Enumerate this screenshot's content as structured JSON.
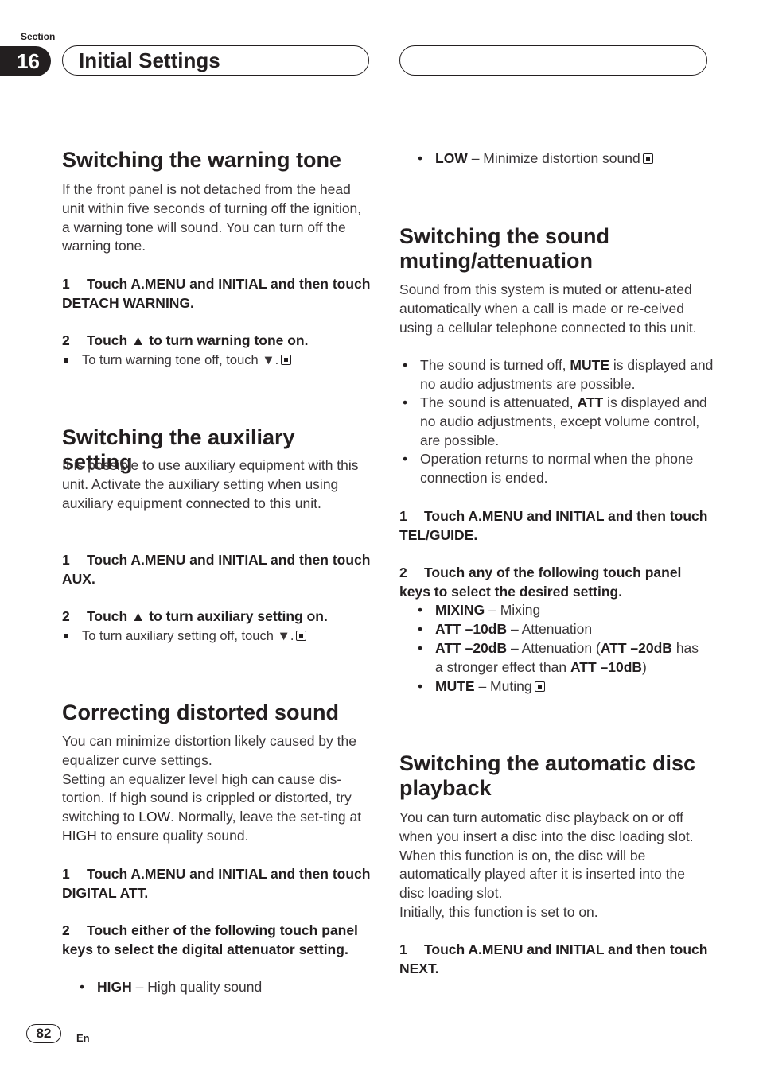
{
  "header": {
    "section_label": "Section",
    "section_number": "16",
    "title": "Initial Settings"
  },
  "warning_tone": {
    "heading": "Switching the warning tone",
    "intro": "If the front panel is not detached from the head unit within five seconds of turning off the ignition, a warning tone will sound. You can turn off the warning tone.",
    "step1_num": "1",
    "step1": "Touch A.MENU and INITIAL and then touch DETACH WARNING.",
    "step2_num": "2",
    "step2": "Touch ▲ to turn warning tone on.",
    "note": "To turn warning tone off, touch ▼."
  },
  "auxiliary": {
    "heading": "Switching the auxiliary setting",
    "intro": "It is possible to use auxiliary equipment with this unit. Activate the auxiliary setting when using auxiliary equipment connected to this unit.",
    "step1_num": "1",
    "step1": "Touch A.MENU and INITIAL and then touch AUX.",
    "step2_num": "2",
    "step2": "Touch ▲ to turn auxiliary setting on.",
    "note": "To turn auxiliary setting off, touch ▼."
  },
  "distorted": {
    "heading": "Correcting distorted sound",
    "intro1": "You can minimize distortion likely caused by the equalizer curve settings.",
    "intro2_a": "Setting an equalizer level high can cause dis-tortion. If high sound is crippled or distorted, try switching to ",
    "intro2_low": "LOW",
    "intro2_b": ". Normally, leave the set-ting at ",
    "intro2_high": "HIGH",
    "intro2_c": " to ensure quality sound.",
    "step1_num": "1",
    "step1": "Touch A.MENU and INITIAL and then touch DIGITAL ATT.",
    "step2_num": "2",
    "step2": "Touch either of the following touch panel keys to select the digital attenuator setting.",
    "options": [
      {
        "key": "HIGH",
        "desc": " – High quality sound"
      },
      {
        "key": "LOW",
        "desc": " – Minimize distortion sound"
      }
    ]
  },
  "muting": {
    "heading": "Switching the sound muting/attenuation",
    "intro": "Sound from this system is muted or attenu-ated automatically when a call is made or re-ceived using a cellular telephone connected to this unit.",
    "bullets": [
      {
        "a": "The sound is turned off, ",
        "b": "MUTE",
        "c": " is displayed and no audio adjustments are possible."
      },
      {
        "a": "The sound is attenuated, ",
        "b": "ATT",
        "c": " is displayed and no audio adjustments, except volume control, are possible."
      },
      {
        "a": "Operation returns to normal when the phone connection is ended.",
        "b": "",
        "c": ""
      }
    ],
    "step1_num": "1",
    "step1": "Touch A.MENU and INITIAL and then touch TEL/GUIDE.",
    "step2_num": "2",
    "step2": "Touch any of the following touch panel keys to select the desired setting.",
    "options": [
      {
        "key": "MIXING",
        "desc": " – Mixing"
      },
      {
        "key": "ATT –10dB",
        "desc": " – Attenuation"
      },
      {
        "key": "ATT –20dB",
        "desc": " – Attenuation (",
        "key2": "ATT –20dB",
        "desc2": " has a stronger effect than ",
        "key3": "ATT –10dB",
        "desc3": ")"
      },
      {
        "key": "MUTE",
        "desc": " – Muting"
      }
    ]
  },
  "auto_disc": {
    "heading": "Switching the automatic disc playback",
    "intro1": "You can turn automatic disc playback on or off when you insert a disc into the disc loading slot. When this function is on, the disc will be automatically played after it is inserted into the disc loading slot.",
    "intro2": "Initially, this function is set to on.",
    "step1_num": "1",
    "step1": "Touch A.MENU and INITIAL and then touch NEXT."
  },
  "footer": {
    "page_number": "82",
    "language": "En"
  }
}
